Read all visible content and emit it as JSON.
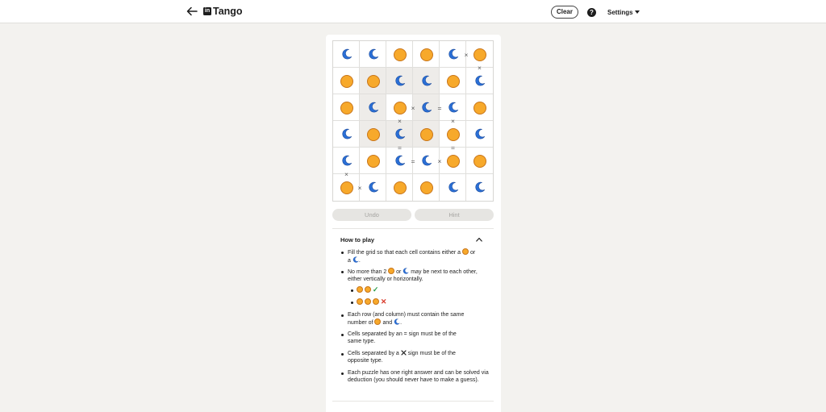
{
  "header": {
    "title": "Tango",
    "logo_text": "in",
    "clear_label": "Clear",
    "help_label": "?",
    "settings_label": "Settings"
  },
  "board": {
    "rows": [
      [
        "moon",
        "moon",
        "sun",
        "sun",
        "moon",
        "sun"
      ],
      [
        "sun",
        "sun",
        "moon",
        "moon",
        "sun",
        "moon"
      ],
      [
        "sun",
        "moon",
        "sun",
        "moon",
        "moon",
        "sun"
      ],
      [
        "moon",
        "sun",
        "moon",
        "sun",
        "sun",
        "moon"
      ],
      [
        "moon",
        "sun",
        "moon",
        "moon",
        "sun",
        "sun"
      ],
      [
        "sun",
        "moon",
        "sun",
        "sun",
        "moon",
        "moon"
      ]
    ],
    "cell_shading": [
      [
        "white",
        "white",
        "white",
        "white",
        "white",
        "white"
      ],
      [
        "white",
        "locked",
        "locked",
        "locked",
        "white",
        "white"
      ],
      [
        "white",
        "locked",
        "white",
        "locked",
        "white",
        "white"
      ],
      [
        "white",
        "locked",
        "locked",
        "locked",
        "white",
        "white"
      ],
      [
        "white",
        "white",
        "white",
        "white",
        "white",
        "white"
      ],
      [
        "white",
        "white",
        "white",
        "white",
        "white",
        "white"
      ]
    ],
    "constraints": [
      {
        "type": "×",
        "between": [
          [
            0,
            4
          ],
          [
            0,
            5
          ]
        ]
      },
      {
        "type": "×",
        "between": [
          [
            0,
            5
          ],
          [
            1,
            5
          ]
        ]
      },
      {
        "type": "×",
        "between": [
          [
            2,
            2
          ],
          [
            2,
            3
          ]
        ]
      },
      {
        "type": "=",
        "between": [
          [
            2,
            3
          ],
          [
            2,
            4
          ]
        ]
      },
      {
        "type": "×",
        "between": [
          [
            2,
            2
          ],
          [
            3,
            2
          ]
        ]
      },
      {
        "type": "×",
        "between": [
          [
            2,
            4
          ],
          [
            3,
            4
          ]
        ]
      },
      {
        "type": "=",
        "between": [
          [
            3,
            2
          ],
          [
            4,
            2
          ]
        ]
      },
      {
        "type": "=",
        "between": [
          [
            3,
            4
          ],
          [
            4,
            4
          ]
        ]
      },
      {
        "type": "=",
        "between": [
          [
            4,
            2
          ],
          [
            4,
            3
          ]
        ]
      },
      {
        "type": "×",
        "between": [
          [
            4,
            3
          ],
          [
            4,
            4
          ]
        ]
      },
      {
        "type": "×",
        "between": [
          [
            4,
            0
          ],
          [
            5,
            0
          ]
        ]
      },
      {
        "type": "×",
        "between": [
          [
            5,
            0
          ],
          [
            5,
            1
          ]
        ]
      }
    ]
  },
  "controls": {
    "undo_label": "Undo",
    "hint_label": "Hint"
  },
  "how_to_play": {
    "title": "How to play",
    "rule1_a": "Fill the grid so that each cell contains either a",
    "rule1_b": "or",
    "rule1_c": "a",
    "rule1_d": ".",
    "rule2_a": "No more than 2",
    "rule2_b": "or",
    "rule2_c": "may be next to each other, either vertically or horizontally.",
    "ok_mark": "✓",
    "bad_mark": "✕",
    "rule3_a": "Each row (and column) must contain the same number of",
    "rule3_b": "and",
    "rule3_c": ".",
    "rule4": "Cells separated by an = sign must be of the same type.",
    "rule5_a": "Cells separated by a",
    "rule5_b": "sign must be of the opposite type.",
    "rule6": "Each puzzle has one right answer and can be solved via deduction (you should never have to make a guess)."
  },
  "colors": {
    "sun_fill": "#f7a92b",
    "sun_border": "#c8751a",
    "moon_fill": "#2a6fd6",
    "background": "#f3f2ef"
  }
}
